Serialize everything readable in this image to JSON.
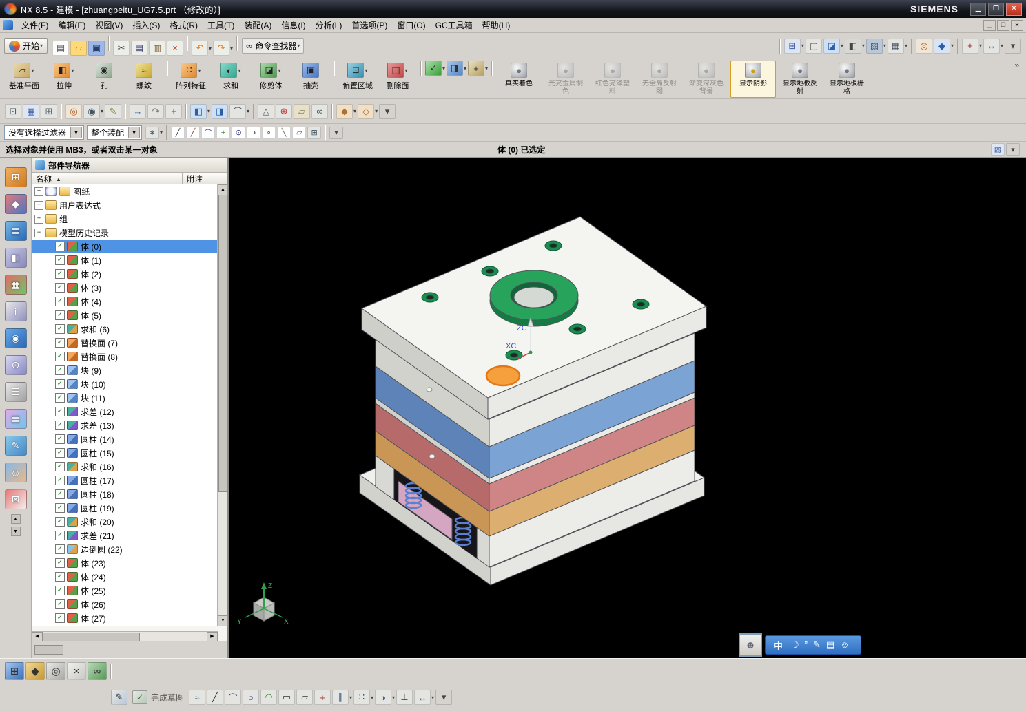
{
  "window": {
    "title": "NX 8.5 - 建模 - [zhuangpeitu_UG7.5.prt （修改的）]",
    "brand": "SIEMENS"
  },
  "menu": {
    "items": [
      "文件(F)",
      "编辑(E)",
      "视图(V)",
      "插入(S)",
      "格式(R)",
      "工具(T)",
      "装配(A)",
      "信息(I)",
      "分析(L)",
      "首选项(P)",
      "窗口(O)",
      "GC工具箱",
      "帮助(H)"
    ]
  },
  "toolbar_standard": {
    "start_label": "开始",
    "command_finder_label": "命令查找器",
    "items_left": [
      {
        "name": "new-file-icon",
        "glyph": "▤",
        "bg": "#fdfdfb",
        "fg": "#556"
      },
      {
        "name": "open-icon",
        "glyph": "▱",
        "bg": "#ffd978",
        "fg": "#8a6d1a"
      },
      {
        "name": "save-icon",
        "glyph": "▣",
        "bg": "#9db8e8",
        "fg": "#2a3f6f"
      },
      {
        "sep": true
      },
      {
        "name": "cut-icon",
        "glyph": "✂",
        "bg": "#eceeea",
        "fg": "#444"
      },
      {
        "name": "copy-icon",
        "glyph": "▤",
        "bg": "#eceeea",
        "fg": "#447"
      },
      {
        "name": "paste-icon",
        "glyph": "▥",
        "bg": "#eceeea",
        "fg": "#7a5c28"
      },
      {
        "name": "delete-icon",
        "glyph": "×",
        "bg": "#eceeea",
        "fg": "#c23b22"
      },
      {
        "sep": true
      },
      {
        "name": "undo-icon",
        "glyph": "↶",
        "bg": "#eceeea",
        "fg": "#e07b1a",
        "dropdown": true
      },
      {
        "name": "redo-icon",
        "glyph": "↷",
        "bg": "#eceeea",
        "fg": "#e07b1a",
        "dropdown": true
      },
      {
        "sep": true
      }
    ],
    "items_right": [
      {
        "sep": true
      },
      {
        "name": "screens-icon",
        "glyph": "⊞",
        "bg": "#dfe6f2",
        "fg": "#3a5fa8",
        "dropdown": true
      },
      {
        "name": "display-mode-icon",
        "glyph": "▢",
        "bg": "#e4e4e0",
        "fg": "#555"
      },
      {
        "name": "model-views-icon",
        "glyph": "◪",
        "bg": "#cfe0f4",
        "fg": "#2a5fa8",
        "dropdown": true
      },
      {
        "name": "render-style-icon",
        "glyph": "◧",
        "bg": "#d8d8d4",
        "fg": "#444",
        "dropdown": true
      },
      {
        "name": "background-icon",
        "glyph": "▨",
        "bg": "#b8c8d8",
        "fg": "#456",
        "dropdown": true
      },
      {
        "name": "window-icon",
        "glyph": "▦",
        "bg": "#e4e4e0",
        "fg": "#456",
        "dropdown": true
      },
      {
        "sep": true
      },
      {
        "name": "show-hide-icon",
        "glyph": "◎",
        "bg": "#f0e6d8",
        "fg": "#b06020"
      },
      {
        "name": "orient-view-icon",
        "glyph": "◆",
        "bg": "#d8e4f4",
        "fg": "#2a5fa8",
        "dropdown": true
      },
      {
        "sep": true
      },
      {
        "name": "measure-icon",
        "glyph": "+",
        "bg": "#e4e4e0",
        "fg": "#a03030",
        "dropdown": true
      },
      {
        "name": "distance-icon",
        "glyph": "↔",
        "bg": "#e4e4e0",
        "fg": "#3a6fb8",
        "dropdown": true
      },
      {
        "name": "toolbar-options-icon",
        "glyph": "▾",
        "bg": "#d6d3ce",
        "fg": "#444"
      }
    ]
  },
  "feature_toolbar": {
    "buttons": [
      {
        "name": "datum-plane-button",
        "label": "基准平面",
        "glyph": "▱",
        "c1": "#e8d8a8",
        "c2": "#c8a868",
        "dropdown": true
      },
      {
        "name": "extrude-button",
        "label": "拉伸",
        "glyph": "◧",
        "c1": "#f8c888",
        "c2": "#e08830",
        "dropdown": true
      },
      {
        "name": "hole-button",
        "label": "孔",
        "glyph": "◉",
        "c1": "#d8e0d8",
        "c2": "#90a890"
      },
      {
        "name": "thread-button",
        "label": "螺纹",
        "glyph": "≈",
        "c1": "#f0e098",
        "c2": "#c8a830"
      },
      {
        "sep": true
      },
      {
        "name": "pattern-feature-button",
        "label": "阵列特征",
        "glyph": "∷",
        "c1": "#f8c888",
        "c2": "#e08830",
        "dropdown": true
      },
      {
        "name": "unite-button",
        "label": "求和",
        "glyph": "◐",
        "c1": "#88d8c8",
        "c2": "#30a890",
        "dropdown": true
      },
      {
        "name": "trim-body-button",
        "label": "修剪体",
        "glyph": "◪",
        "c1": "#a8d8a8",
        "c2": "#509850",
        "dropdown": true
      },
      {
        "name": "shell-button",
        "label": "抽壳",
        "glyph": "▣",
        "c1": "#98b8e8",
        "c2": "#4878c8"
      },
      {
        "sep": true
      },
      {
        "name": "offset-region-button",
        "label": "偏置区域",
        "glyph": "⊡",
        "c1": "#98d0e0",
        "c2": "#3890b0",
        "dropdown": true
      },
      {
        "name": "delete-face-button",
        "label": "删除面",
        "glyph": "◫",
        "c1": "#e89898",
        "c2": "#c04848",
        "dropdown": true
      },
      {
        "sep": true
      }
    ],
    "extra_icons": [
      {
        "name": "expression-check-icon",
        "glyph": "✓",
        "c1": "#a8e0a8",
        "c2": "#38a038",
        "dropdown": true
      },
      {
        "name": "sync-modeling-icon",
        "glyph": "◨",
        "c1": "#a8c8e8",
        "c2": "#5888c8",
        "dropdown": true
      },
      {
        "name": "datum-csys-icon",
        "glyph": "+",
        "c1": "#e8e0c0",
        "c2": "#b8a060",
        "dropdown": true
      }
    ]
  },
  "shading_toolbar": {
    "buttons": [
      {
        "name": "true-shading-button",
        "label": "真实着色",
        "state": "normal"
      },
      {
        "name": "shiny-metal-button",
        "label": "光亮金属制色",
        "state": "disabled"
      },
      {
        "name": "red-plastic-button",
        "label": "红色亮泽塑料",
        "state": "disabled"
      },
      {
        "name": "no-global-reflection-button",
        "label": "无全局反射图",
        "state": "disabled"
      },
      {
        "name": "gradient-gray-background-button",
        "label": "渐变深灰色背景",
        "state": "disabled"
      },
      {
        "name": "show-shadow-button",
        "label": "显示阴影",
        "state": "active"
      },
      {
        "name": "floor-reflection-button",
        "label": "显示地板反射",
        "state": "normal"
      },
      {
        "name": "floor-grid-button",
        "label": "显示地板栅格",
        "state": "normal"
      }
    ],
    "overflow_glyph": "»"
  },
  "view_toolbar": {
    "items": [
      {
        "name": "object-display-icon",
        "glyph": "⊡",
        "bg": "#e4e4e0",
        "fg": "#456"
      },
      {
        "name": "layer-settings-icon",
        "glyph": "▦",
        "bg": "#dfe6f2",
        "fg": "#3a5fa8"
      },
      {
        "name": "work-grid-icon",
        "glyph": "⊞",
        "bg": "#e4e4e0",
        "fg": "#567"
      },
      {
        "sep": true
      },
      {
        "name": "immediate-hide-icon",
        "glyph": "◎",
        "bg": "#f0e6d8",
        "fg": "#b06020"
      },
      {
        "name": "show-hide-toggle-icon",
        "glyph": "◉",
        "bg": "#e4e4e0",
        "fg": "#456",
        "dropdown": true
      },
      {
        "name": "edit-object-display-icon",
        "glyph": "✎",
        "bg": "#e4e4e0",
        "fg": "#884"
      },
      {
        "sep": true
      },
      {
        "name": "move-object-icon",
        "glyph": "↔",
        "bg": "#e4e4e0",
        "fg": "#3a6fb8"
      },
      {
        "name": "sync-views-icon",
        "glyph": "↷",
        "bg": "#e4e4e0",
        "fg": "#777"
      },
      {
        "name": "wcs-dynamics-icon",
        "glyph": "+",
        "bg": "#e4e4e0",
        "fg": "#a03030"
      },
      {
        "sep": true
      },
      {
        "name": "new-section-icon",
        "glyph": "◧",
        "bg": "#cfe0f4",
        "fg": "#2a5fa8",
        "dropdown": true
      },
      {
        "name": "clip-section-icon",
        "glyph": "◨",
        "bg": "#cfe0f4",
        "fg": "#2a5fa8"
      },
      {
        "name": "curve-analysis-icon",
        "glyph": "⌒",
        "bg": "#e4e4e0",
        "fg": "#456",
        "dropdown": true
      },
      {
        "sep": true
      },
      {
        "name": "measure-angle-icon",
        "glyph": "△",
        "bg": "#e4e4e0",
        "fg": "#567"
      },
      {
        "name": "spot-weld-icon",
        "glyph": "⊕",
        "bg": "#e4e4e0",
        "fg": "#c03030"
      },
      {
        "name": "datum-grid-icon",
        "glyph": "▱",
        "bg": "#e8e0c8",
        "fg": "#886"
      },
      {
        "name": "relations-icon",
        "glyph": "∞",
        "bg": "#e4e4e0",
        "fg": "#456"
      },
      {
        "sep": true
      },
      {
        "name": "transform-icon",
        "glyph": "◆",
        "bg": "#f0e0c8",
        "fg": "#b07030",
        "dropdown": true
      },
      {
        "name": "assembly-tools-icon",
        "glyph": "◇",
        "bg": "#f0e0c8",
        "fg": "#b07030",
        "dropdown": true
      },
      {
        "name": "view-toolbar-options-icon",
        "glyph": "▾",
        "bg": "#d6d3ce",
        "fg": "#444"
      }
    ]
  },
  "selection_bar": {
    "filter_value": "没有选择过滤器",
    "scope_value": "整个装配",
    "items": [
      {
        "name": "snap-point-toggle-icon",
        "glyph": "∗",
        "bg": "#e4e4e0",
        "fg": "#456",
        "dropdown": true
      },
      {
        "sep": true
      },
      {
        "name": "snap-end-point-icon",
        "glyph": "╱",
        "bg": "#fff",
        "fg": "#333"
      },
      {
        "name": "snap-mid-point-icon",
        "glyph": "╱",
        "bg": "#fff",
        "fg": "#833"
      },
      {
        "name": "snap-control-point-icon",
        "glyph": "⌒",
        "bg": "#fff",
        "fg": "#338"
      },
      {
        "name": "snap-intersection-icon",
        "glyph": "+",
        "bg": "#fff",
        "fg": "#383"
      },
      {
        "name": "snap-arc-center-icon",
        "glyph": "⊙",
        "bg": "#fff",
        "fg": "#338"
      },
      {
        "name": "snap-quadrant-icon",
        "glyph": "◑",
        "bg": "#fff",
        "fg": "#666"
      },
      {
        "name": "snap-existing-point-icon",
        "glyph": "∘",
        "bg": "#fff",
        "fg": "#333"
      },
      {
        "name": "snap-point-on-curve-icon",
        "glyph": "╲",
        "bg": "#fff",
        "fg": "#666"
      },
      {
        "name": "snap-point-on-face-icon",
        "glyph": "▱",
        "bg": "#fff",
        "fg": "#666"
      },
      {
        "name": "snap-bounded-grid-icon",
        "glyph": "⊞",
        "bg": "#e4e4e0",
        "fg": "#456"
      },
      {
        "sep": true
      },
      {
        "name": "selection-options-icon",
        "glyph": "▾",
        "bg": "#d6d3ce",
        "fg": "#444"
      }
    ]
  },
  "prompt_bar": {
    "message": "选择对象并使用 MB3，或者双击某一对象",
    "status": "体 (0) 已选定",
    "right_icons": [
      {
        "name": "prompt-dock-icon",
        "glyph": "▨",
        "bg": "#dfe6f2",
        "fg": "#3a5fa8"
      },
      {
        "name": "prompt-expand-icon",
        "glyph": "▾",
        "bg": "#d6d3ce",
        "fg": "#444"
      }
    ]
  },
  "left_strip": {
    "items": [
      {
        "name": "assembly-navigator-icon",
        "glyph": "⊞",
        "c1": "#f0b060",
        "c2": "#d07820"
      },
      {
        "name": "constraint-navigator-icon",
        "glyph": "◆",
        "c1": "#e87878",
        "c2": "#4878c8"
      },
      {
        "name": "part-navigator-icon",
        "glyph": "▤",
        "c1": "#78b8e8",
        "c2": "#2868b8"
      },
      {
        "name": "reuse-library-icon",
        "glyph": "◧",
        "c1": "#c8c8e8",
        "c2": "#8888b8"
      },
      {
        "name": "hd3d-tools-icon",
        "glyph": "▦",
        "c1": "#e86868",
        "c2": "#68c868"
      },
      {
        "name": "dependencies-info-icon",
        "glyph": "i",
        "c1": "#e8e8e8",
        "c2": "#9090c0"
      },
      {
        "name": "web-browser-icon",
        "glyph": "◉",
        "c1": "#68a8e8",
        "c2": "#2868b8"
      },
      {
        "name": "history-palette-icon",
        "glyph": "⊙",
        "c1": "#d8d8f0",
        "c2": "#8888c8"
      },
      {
        "name": "notes-icon",
        "glyph": "☰",
        "c1": "#e8e8e8",
        "c2": "#a0a0a0"
      },
      {
        "name": "color-palette-icon",
        "glyph": "▤",
        "c1": "#e8a8e8",
        "c2": "#68c8e8"
      },
      {
        "name": "sketcher-icon",
        "glyph": "✎",
        "c1": "#88c8e8",
        "c2": "#4888c8"
      },
      {
        "name": "roles-icon",
        "glyph": "☺",
        "c1": "#88b8e8",
        "c2": "#e8b888"
      },
      {
        "name": "touch-mode-icon",
        "glyph": "⊠",
        "c1": "#e87878",
        "c2": "#f0f0f0"
      }
    ]
  },
  "navigator": {
    "title": "部件导航器",
    "col_name": "名称",
    "col_note": "附注",
    "groups": [
      {
        "label": "图纸",
        "expanded": false,
        "clock": true
      },
      {
        "label": "用户表达式",
        "expanded": false
      },
      {
        "label": "组",
        "expanded": false
      },
      {
        "label": "模型历史记录",
        "expanded": true
      }
    ],
    "history": [
      {
        "label": "体 (0)",
        "type": "body",
        "selected": true
      },
      {
        "label": "体 (1)",
        "type": "body"
      },
      {
        "label": "体 (2)",
        "type": "body"
      },
      {
        "label": "体 (3)",
        "type": "body"
      },
      {
        "label": "体 (4)",
        "type": "body"
      },
      {
        "label": "体 (5)",
        "type": "body"
      },
      {
        "label": "求和 (6)",
        "type": "unite"
      },
      {
        "label": "替换面 (7)",
        "type": "replace"
      },
      {
        "label": "替换面 (8)",
        "type": "replace"
      },
      {
        "label": "块 (9)",
        "type": "block"
      },
      {
        "label": "块 (10)",
        "type": "block"
      },
      {
        "label": "块 (11)",
        "type": "block"
      },
      {
        "label": "求差 (12)",
        "type": "subtract"
      },
      {
        "label": "求差 (13)",
        "type": "subtract"
      },
      {
        "label": "圆柱 (14)",
        "type": "cylinder"
      },
      {
        "label": "圆柱 (15)",
        "type": "cylinder"
      },
      {
        "label": "求和 (16)",
        "type": "unite"
      },
      {
        "label": "圆柱 (17)",
        "type": "cylinder"
      },
      {
        "label": "圆柱 (18)",
        "type": "cylinder"
      },
      {
        "label": "圆柱 (19)",
        "type": "cylinder"
      },
      {
        "label": "求和 (20)",
        "type": "unite"
      },
      {
        "label": "求差 (21)",
        "type": "subtract"
      },
      {
        "label": "边倒圆 (22)",
        "type": "blend"
      },
      {
        "label": "体 (23)",
        "type": "body"
      },
      {
        "label": "体 (24)",
        "type": "body"
      },
      {
        "label": "体 (25)",
        "type": "body"
      },
      {
        "label": "体 (26)",
        "type": "body"
      },
      {
        "label": "体 (27)",
        "type": "body"
      }
    ]
  },
  "viewport": {
    "axis_zc": "ZC",
    "axis_xc": "XC",
    "triad_z": "Z",
    "triad_x": "X",
    "triad_y": "Y",
    "model_colors": {
      "top_white": "#f4f4f1",
      "top_white_left": "#cfcfca",
      "top_white_right": "#e9e9e5",
      "plate_white_left": "#d2d2cd",
      "plate_white_right": "#ebebe7",
      "blue_left": "#5d83b8",
      "blue_right": "#7ba3d4",
      "red_left": "#b76a6a",
      "red_right": "#cf8585",
      "orange_left": "#c99655",
      "orange_right": "#dcaf70",
      "base_top": "#f0f0ec",
      "base_left": "#d2d2cd",
      "base_right": "#e6e6e2",
      "ring_top": "#27a35c",
      "ring_side": "#167a44",
      "spring_blue": "#5d7fd0",
      "ejector_pink": "#d4a6c2",
      "selection_highlight": "#f5a03c"
    }
  },
  "ime": {
    "lang": "中",
    "glyphs": [
      "☽",
      "”",
      "✎",
      "▤",
      "☺"
    ]
  },
  "bottom_bar": {
    "items_a": [
      {
        "name": "new-window-icon",
        "glyph": "⊞",
        "c1": "#a8c8f0",
        "c2": "#3a6fb8"
      },
      {
        "name": "cascade-windows-icon",
        "glyph": "◆",
        "c1": "#f0d898",
        "c2": "#c89830"
      },
      {
        "name": "zoom-window-icon",
        "glyph": "◎",
        "c1": "#e8e8e4",
        "c2": "#a8a8a4"
      },
      {
        "name": "deselect-all-icon",
        "glyph": "×",
        "c1": "#f0f0ec",
        "c2": "#c8c8c4"
      },
      {
        "name": "collaborate-icon",
        "glyph": "∞",
        "c1": "#b8d8b8",
        "c2": "#589858"
      },
      {
        "sep": true
      }
    ],
    "finish_sketch_label": "完成草图",
    "items_b": [
      {
        "name": "sketch-tools-icon",
        "glyph": "✎",
        "c1": "#e8e8e4",
        "c2": "#b8c8d8"
      },
      {
        "name": "profile-icon",
        "glyph": "≈",
        "bg": "#e4e4e0",
        "fg": "#358"
      },
      {
        "name": "line-icon",
        "glyph": "╱",
        "bg": "#e4e4e0",
        "fg": "#333"
      },
      {
        "name": "arc-icon",
        "glyph": "⌒",
        "bg": "#e4e4e0",
        "fg": "#338"
      },
      {
        "name": "circle-icon",
        "glyph": "○",
        "bg": "#e4e4e0",
        "fg": "#338"
      },
      {
        "name": "fillet-icon",
        "glyph": "◠",
        "bg": "#e4e4e0",
        "fg": "#383"
      },
      {
        "name": "rectangle-icon",
        "glyph": "▭",
        "bg": "#e4e4e0",
        "fg": "#333"
      },
      {
        "name": "polygon-icon",
        "glyph": "▱",
        "bg": "#e4e4e0",
        "fg": "#333"
      },
      {
        "name": "point-icon",
        "glyph": "+",
        "bg": "#e4e4e0",
        "fg": "#a33"
      },
      {
        "name": "offset-curve-icon",
        "glyph": "∥",
        "bg": "#e4e4e0",
        "fg": "#358",
        "dropdown": true
      },
      {
        "name": "pattern-curve-icon",
        "glyph": "∷",
        "bg": "#e4e4e0",
        "fg": "#358",
        "dropdown": true
      },
      {
        "name": "mirror-curve-icon",
        "glyph": "◑",
        "bg": "#e4e4e0",
        "fg": "#358",
        "dropdown": true
      },
      {
        "name": "constraints-icon",
        "glyph": "⊥",
        "bg": "#e4e4e0",
        "fg": "#333"
      },
      {
        "name": "dimensions-icon",
        "glyph": "↔",
        "bg": "#e4e4e0",
        "fg": "#338",
        "dropdown": true
      },
      {
        "name": "sketch-options-icon",
        "glyph": "▾",
        "bg": "#d6d3ce",
        "fg": "#444"
      }
    ]
  }
}
